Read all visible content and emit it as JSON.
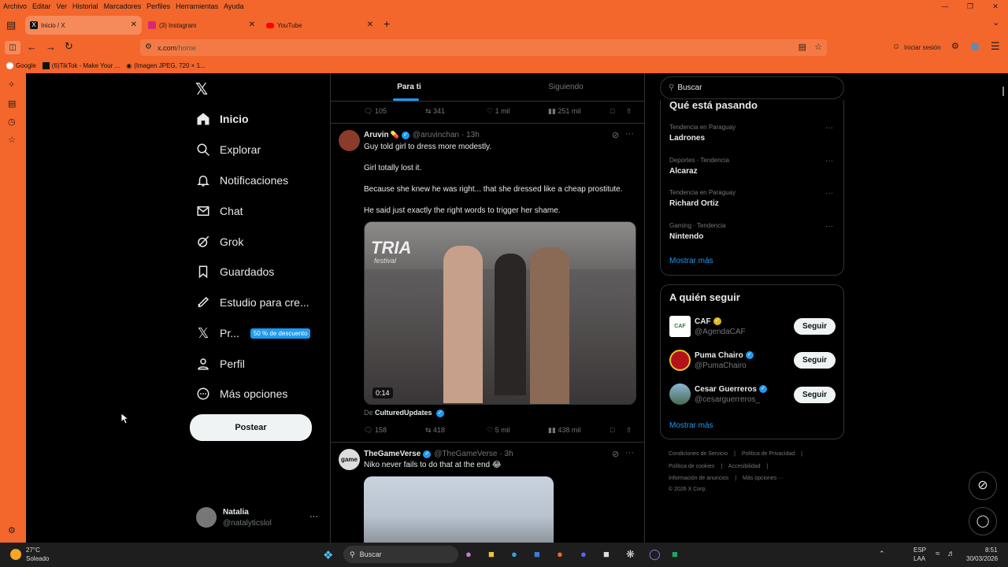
{
  "menu": [
    "Archivo",
    "Editar",
    "Ver",
    "Historial",
    "Marcadores",
    "Perfiles",
    "Herramientas",
    "Ayuda"
  ],
  "tabs": [
    {
      "label": "Inicio / X",
      "color": "#111"
    },
    {
      "label": "(3) Instagram",
      "color": "#d62976"
    },
    {
      "label": "YouTube",
      "color": "#ff0000"
    }
  ],
  "url": {
    "host": "x.com",
    "path": "/home"
  },
  "signin_label": "Iniciar sesión",
  "bookmarks": [
    "Google",
    "(6)TikTok - Make Your ...",
    "(Imagen JPEG, 720 × 1..."
  ],
  "nav": {
    "items": [
      {
        "label": "Inicio",
        "icon": "home-icon"
      },
      {
        "label": "Explorar",
        "icon": "search-icon"
      },
      {
        "label": "Notificaciones",
        "icon": "bell-icon"
      },
      {
        "label": "Chat",
        "icon": "mail-icon"
      },
      {
        "label": "Grok",
        "icon": "grok-icon"
      },
      {
        "label": "Guardados",
        "icon": "bookmark-icon"
      },
      {
        "label": "Estudio para cre...",
        "icon": "rocket-icon"
      },
      {
        "label": "Pr...",
        "icon": "x-logo-icon"
      },
      {
        "label": "Perfil",
        "icon": "user-icon"
      },
      {
        "label": "Más opciones",
        "icon": "more-circle-icon"
      }
    ],
    "promo_badge": "50 % de descuento",
    "post_button": "Postear",
    "user": {
      "name": "Natalia",
      "handle": "@natalyticslol"
    }
  },
  "feed_tabs": [
    "Para ti",
    "Siguiendo"
  ],
  "top_actions": {
    "replies": "105",
    "reposts": "341",
    "likes": "1 mil",
    "views": "251 mil"
  },
  "tweet1": {
    "name": "Aruvin",
    "emoji": "💊",
    "handle": "@aruvinchan",
    "time": "· 13h",
    "lines": [
      "Guy told girl to dress more modestly.",
      "Girl totally lost it.",
      "Because she knew he was right... that she dressed like a cheap prostitute.",
      "He said just exactly the right words to trigger her shame."
    ],
    "video_duration": "0:14",
    "video_sign": "TRIA",
    "video_sign2": "festival",
    "from_label": "De",
    "from_account": "CulturedUpdates",
    "replies": "158",
    "reposts": "418",
    "likes": "5 mil",
    "views": "438 mil"
  },
  "tweet2": {
    "name": "TheGameVerse",
    "avatar_text": "game",
    "handle": "@TheGameVerse",
    "time": "· 3h",
    "text": "Niko never fails to do that at the end 😂"
  },
  "search_placeholder": "Buscar",
  "trends_title": "Qué está pasando",
  "trends": [
    {
      "meta": "Tendencia en Paraguay",
      "name": "Ladrones"
    },
    {
      "meta": "Deportes · Tendencia",
      "name": "Alcaraz"
    },
    {
      "meta": "Tendencia en Paraguay",
      "name": "Richard Ortiz"
    },
    {
      "meta": "Gaming · Tendencia",
      "name": "Nintendo"
    }
  ],
  "show_more": "Mostrar más",
  "follow_title": "A quién seguir",
  "follows": [
    {
      "name": "CAF",
      "handle": "@AgendaCAF",
      "badge": "gold",
      "avatar_text": "CAF"
    },
    {
      "name": "Puma Chairo",
      "handle": "@PumaChairo",
      "badge": "blue",
      "avatar_text": ""
    },
    {
      "name": "Cesar Guerreros",
      "handle": "@cesarguerreros_",
      "badge": "blue",
      "avatar_text": ""
    }
  ],
  "follow_button": "Seguir",
  "footer": [
    "Condiciones de Servicio",
    "|",
    "Política de Privacidad",
    "|",
    "Política de cookies",
    "|",
    "Accesibilidad",
    "|",
    "Información de anuncios",
    "|",
    "Más opciones ···",
    "© 2026 X Corp."
  ],
  "taskbar": {
    "temp": "27°C",
    "weather": "Soleado",
    "search": "Buscar",
    "lang": "ESP",
    "lang2": "LAA",
    "time": "8:51",
    "date": "30/03/2026"
  },
  "colors": {
    "browser": "#f3662c",
    "accent": "#1d9bf0",
    "bg": "#000000"
  }
}
